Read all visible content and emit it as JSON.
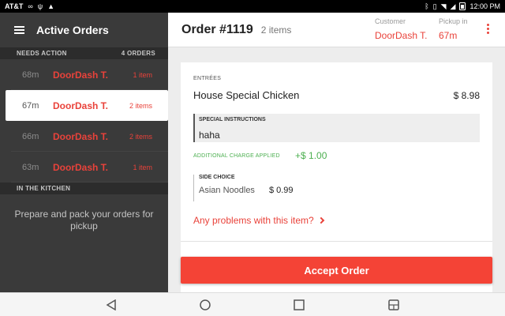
{
  "status_bar": {
    "carrier": "AT&T",
    "time": "12:00 PM"
  },
  "sidebar": {
    "title": "Active Orders",
    "needs_action": {
      "label": "NEEDS ACTION",
      "count": "4 ORDERS",
      "orders": [
        {
          "time": "68m",
          "name": "DoorDash T.",
          "items": "1 item",
          "selected": false
        },
        {
          "time": "67m",
          "name": "DoorDash T.",
          "items": "2 items",
          "selected": true
        },
        {
          "time": "66m",
          "name": "DoorDash T.",
          "items": "2 items",
          "selected": false
        },
        {
          "time": "63m",
          "name": "DoorDash T.",
          "items": "1 item",
          "selected": false
        }
      ]
    },
    "kitchen": {
      "label": "IN THE KITCHEN",
      "message": "Prepare and pack your orders for pickup"
    }
  },
  "header": {
    "order_number": "Order #1119",
    "item_count": "2 items",
    "customer_label": "Customer",
    "customer_value": "DoorDash T.",
    "pickup_label": "Pickup in",
    "pickup_value": "67m"
  },
  "card": {
    "category": "ENTRÉES",
    "item_name": "House Special Chicken",
    "item_price": "$ 8.98",
    "instructions_label": "SPECIAL INSTRUCTIONS",
    "instructions_text": "haha",
    "additional_label": "ADDITIONAL CHARGE APPLIED",
    "additional_value": "+$ 1.00",
    "side_label": "SIDE CHOICE",
    "side_name": "Asian Noodles",
    "side_price": "$ 0.99",
    "problem_link": "Any problems with this item?"
  },
  "accept_button": "Accept Order",
  "colors": {
    "accent": "#f44336",
    "sidebar_bg": "#3a3a3a",
    "green": "#4caf50"
  }
}
